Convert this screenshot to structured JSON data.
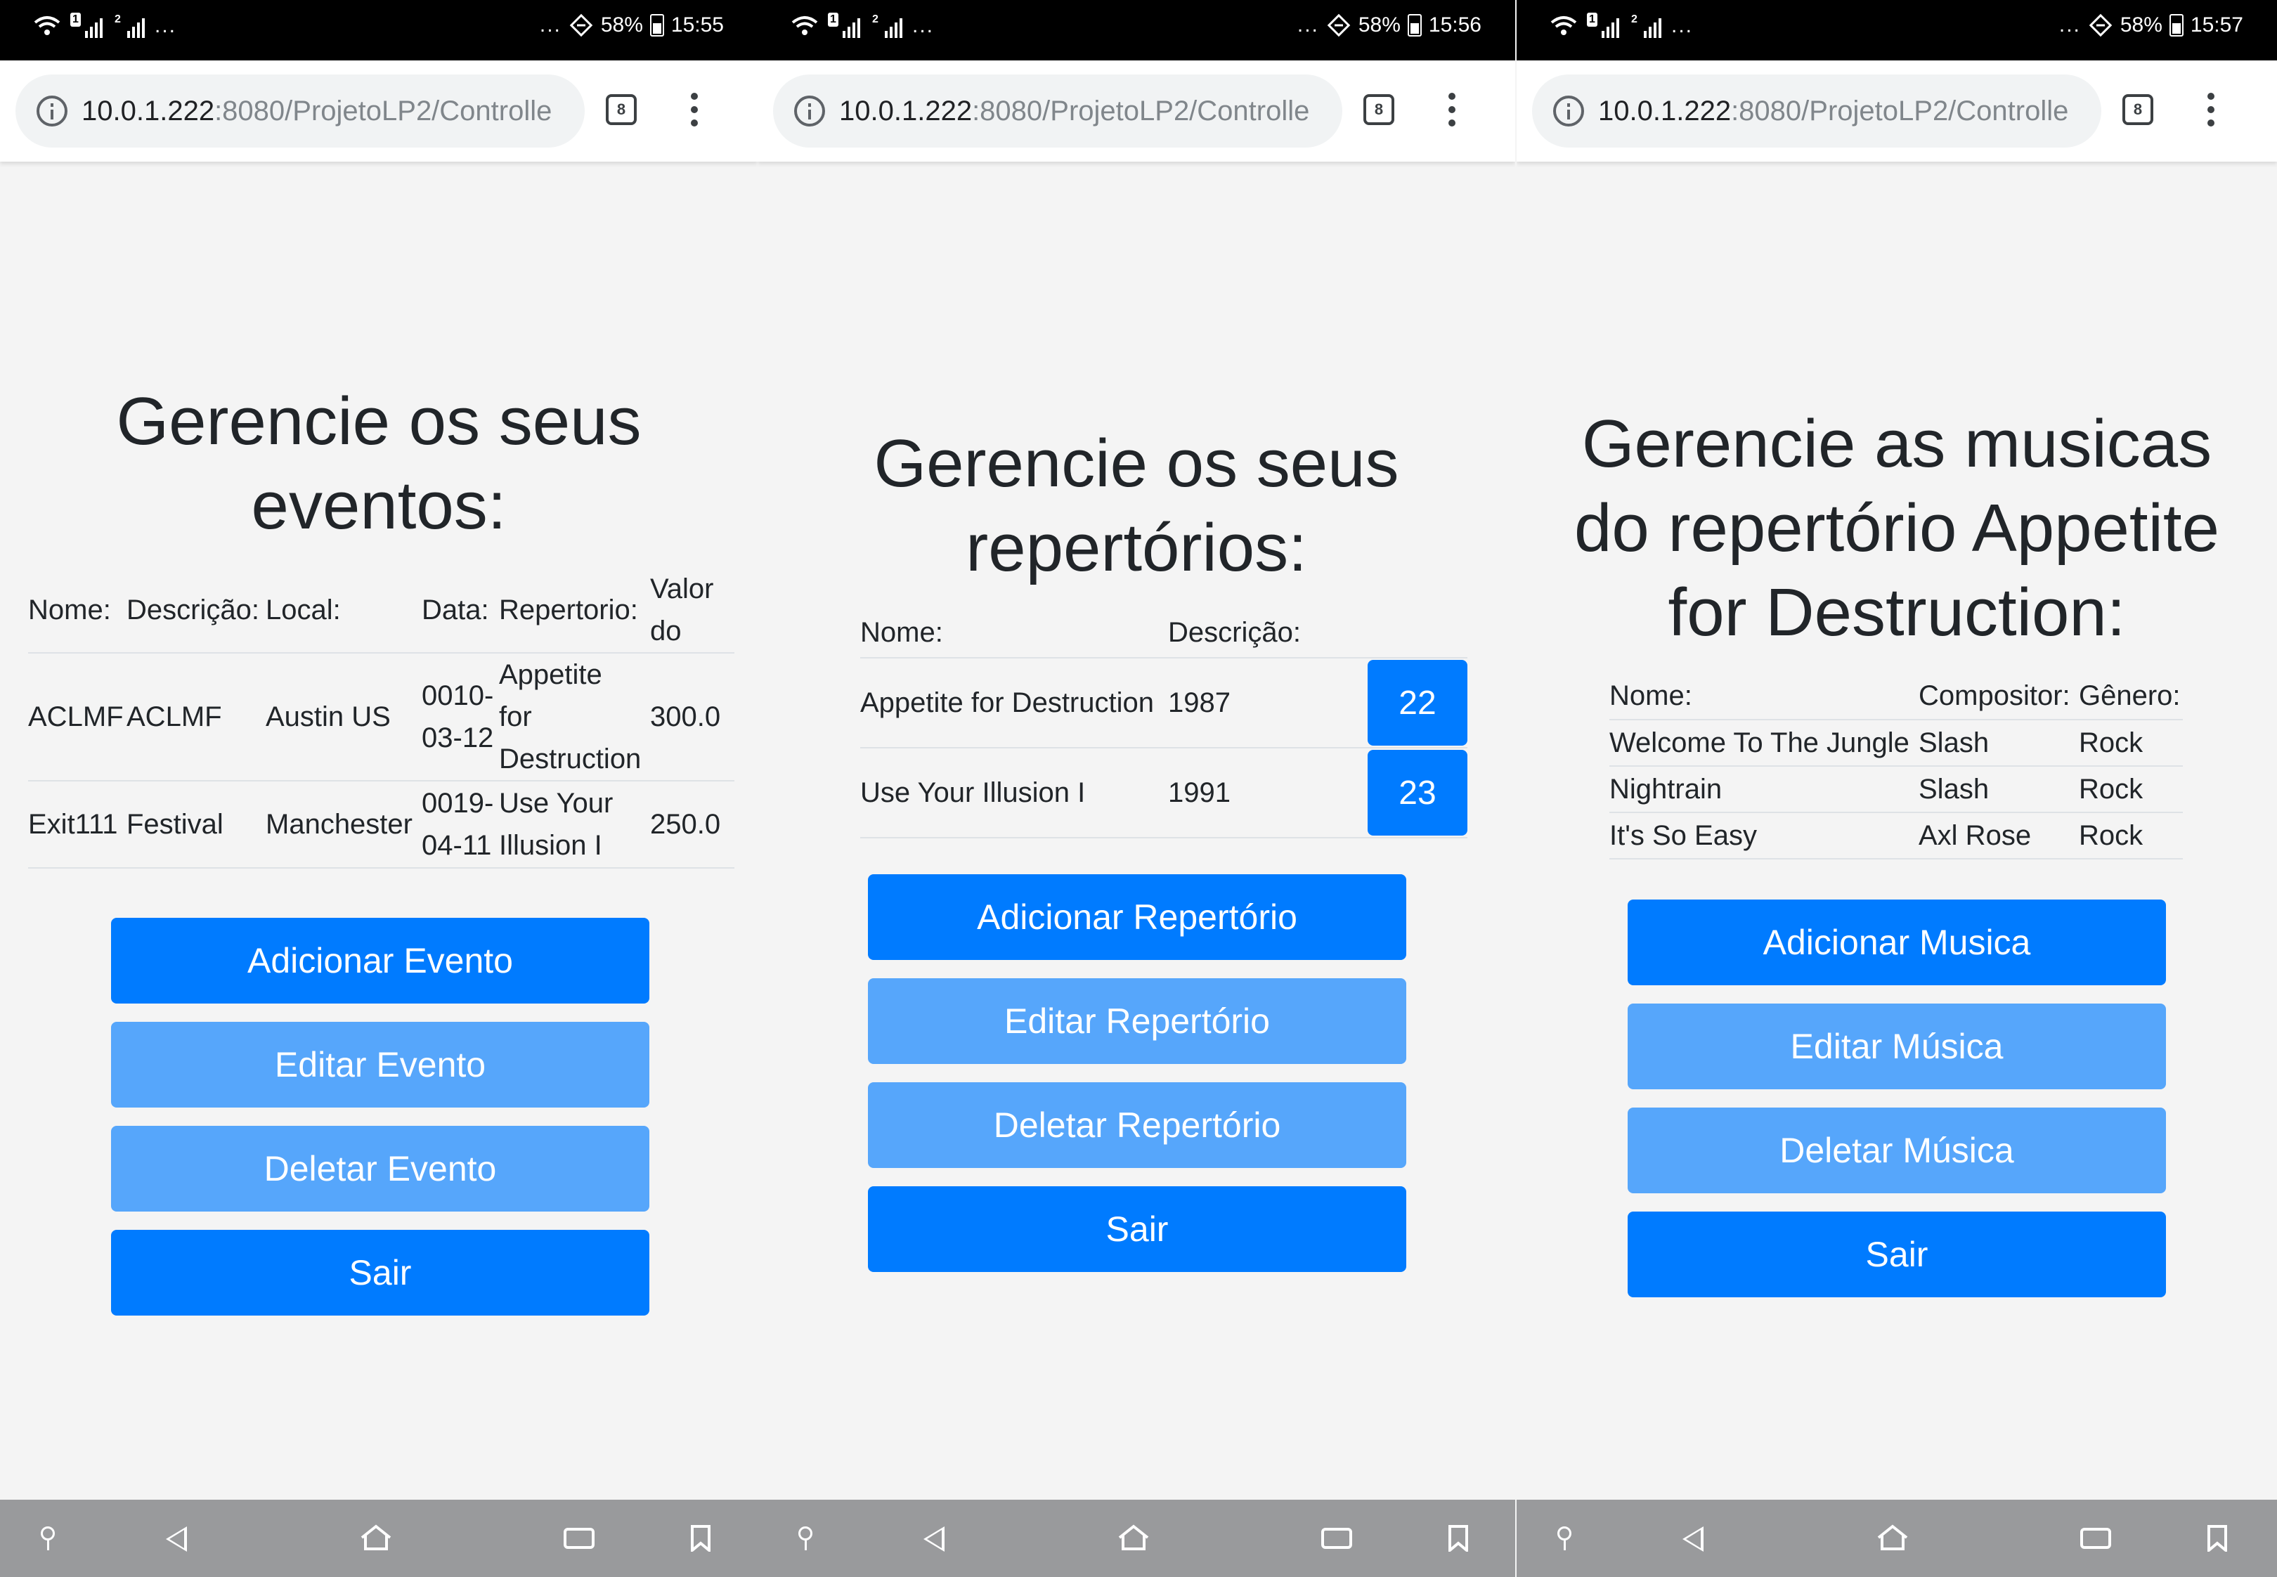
{
  "phones": [
    {
      "status": {
        "battery": "58%",
        "time": "15:55",
        "sim1": "1",
        "sim2": "2",
        "dots": "...",
        "right_dots": "..."
      },
      "browser": {
        "url_host": "10.0.1.222",
        "url_rest": ":8080/ProjetoLP2/Controlle",
        "tab_count": "8"
      },
      "title_lines": [
        "Gerencie os seus",
        "eventos:"
      ],
      "table": {
        "headers": [
          "Nome:",
          "Descrição:",
          "Local:",
          "Data:",
          "Repertorio:",
          "Valor do Ingresso:"
        ],
        "rows": [
          [
            "ACLMF",
            "ACLMF",
            "Austin US",
            "0010-03-12",
            "Appetite for Destruction",
            "300.0"
          ],
          [
            "Exit111",
            "Festival",
            "Manchester",
            "0019-04-11",
            "Use Your Illusion I",
            "250.0"
          ]
        ]
      },
      "buttons": {
        "add": "Adicionar Evento",
        "edit": "Editar Evento",
        "delete": "Deletar Evento",
        "exit": "Sair"
      }
    },
    {
      "status": {
        "battery": "58%",
        "time": "15:56",
        "sim1": "1",
        "sim2": "2",
        "dots": "...",
        "right_dots": "..."
      },
      "browser": {
        "url_host": "10.0.1.222",
        "url_rest": ":8080/ProjetoLP2/Controlle",
        "tab_count": "8"
      },
      "title_lines": [
        "Gerencie os seus",
        "repertórios:"
      ],
      "table": {
        "headers": [
          "Nome:",
          "Descrição:"
        ],
        "rows": [
          {
            "nome": "Appetite for Destruction",
            "descricao": "1987",
            "id": "22"
          },
          {
            "nome": "Use Your Illusion I",
            "descricao": "1991",
            "id": "23"
          }
        ]
      },
      "buttons": {
        "add": "Adicionar Repertório",
        "edit": "Editar Repertório",
        "delete": "Deletar Repertório",
        "exit": "Sair"
      }
    },
    {
      "status": {
        "battery": "58%",
        "time": "15:57",
        "sim1": "1",
        "sim2": "2",
        "dots": "...",
        "right_dots": "..."
      },
      "browser": {
        "url_host": "10.0.1.222",
        "url_rest": ":8080/ProjetoLP2/Controlle",
        "tab_count": "8"
      },
      "title_lines": [
        "Gerencie as musicas",
        "do repertório Appetite",
        "for Destruction:"
      ],
      "table": {
        "headers": [
          "Nome:",
          "Compositor:",
          "Gênero:"
        ],
        "rows": [
          [
            "Welcome To The Jungle",
            "Slash",
            "Rock"
          ],
          [
            "Nightrain",
            "Slash",
            "Rock"
          ],
          [
            "It's So Easy",
            "Axl Rose",
            "Rock"
          ]
        ]
      },
      "buttons": {
        "add": "Adicionar Musica",
        "edit": "Editar Música",
        "delete": "Deletar Música",
        "exit": "Sair"
      }
    }
  ],
  "colors": {
    "primary": "#007bff",
    "primary_light": "#56a6fb",
    "page_bg": "#f4f4f4",
    "nav_bg": "#999a9c",
    "status_bg": "#000000"
  },
  "icons": [
    "wifi-icon",
    "signal-icon",
    "data-saver-icon",
    "battery-icon",
    "info-icon",
    "tabs-icon",
    "menu-icon",
    "pin-icon",
    "back-icon",
    "home-icon",
    "recents-icon",
    "bookmark-icon"
  ]
}
